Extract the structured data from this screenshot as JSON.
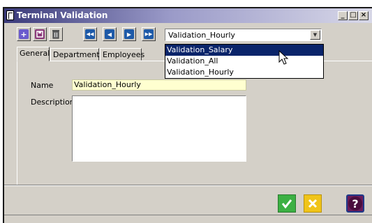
{
  "window": {
    "title": "Terminal Validation",
    "controls": {
      "minimize": "_",
      "maximize": "□",
      "close": "×"
    }
  },
  "toolbar": {
    "buttons": [
      {
        "icon": "add-icon",
        "label": "+"
      },
      {
        "icon": "save-icon",
        "label": ""
      },
      {
        "icon": "delete-icon",
        "label": ""
      },
      {
        "icon": "first-record-icon",
        "label": "◀◀"
      },
      {
        "icon": "previous-record-icon",
        "label": "◀"
      },
      {
        "icon": "next-record-icon",
        "label": "▶"
      },
      {
        "icon": "last-record-icon",
        "label": "▶▶"
      }
    ],
    "selector": {
      "value": "Validation_Hourly",
      "options": [
        "Validation_Salary",
        "Validation_All",
        "Validation_Hourly"
      ],
      "highlighted": "Validation_Salary"
    }
  },
  "tabs": [
    "General",
    "Department",
    "Employees"
  ],
  "active_tab": "General",
  "form": {
    "name_label": "Name",
    "name_value": "Validation_Hourly",
    "description_label": "Description",
    "description_value": ""
  },
  "colors": {
    "accent_selection": "#0a246a",
    "name_field_bg": "#ffffd0",
    "ok_button": "#3cb043",
    "cancel_button": "#f0c419",
    "help_button": "#6a1b5a"
  }
}
